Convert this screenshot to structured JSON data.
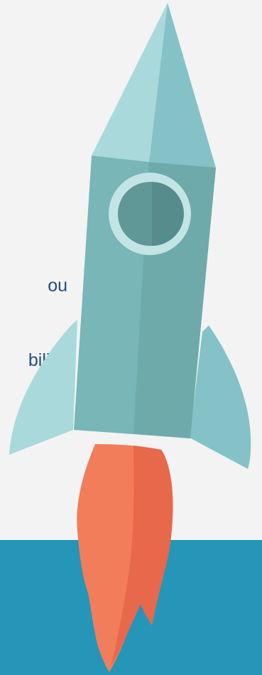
{
  "visible_text": {
    "line_1": "ou",
    "line_2": "bility."
  },
  "colors": {
    "background": "#f3f3f3",
    "bottom_band": "#2596b7",
    "text": "#1f4f82",
    "rocket_body": "#78b6b7",
    "rocket_body_shadow": "#6eaaa9",
    "rocket_nose_light": "#a9d9db",
    "rocket_nose_shadow": "#84c2c8",
    "window_ring": "#c3e4e4",
    "window_glass": "#5f9896",
    "flame_primary": "#f27d5a",
    "flame_shadow": "#e7684b"
  },
  "icons": {
    "rocket": "rocket-illustration"
  }
}
